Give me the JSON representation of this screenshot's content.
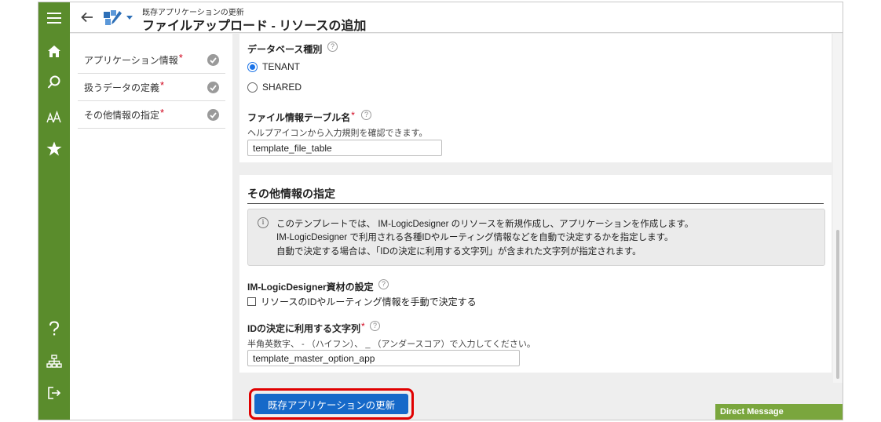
{
  "header": {
    "subtitle": "既存アプリケーションの更新",
    "title": "ファイルアップロード - リソースの追加"
  },
  "rail": {
    "icons": [
      "menu-icon",
      "home-icon",
      "search-icon",
      "font-size-icon",
      "star-icon",
      "help-icon",
      "sitemap-icon",
      "logout-icon"
    ]
  },
  "steps": [
    {
      "label": "アプリケーション情報",
      "required": "*"
    },
    {
      "label": "扱うデータの定義",
      "required": "*"
    },
    {
      "label": "その他情報の指定",
      "required": "*"
    }
  ],
  "db_type": {
    "label": "データベース種別",
    "options": [
      "TENANT",
      "SHARED"
    ],
    "selected": "TENANT"
  },
  "file_table": {
    "label": "ファイル情報テーブル名",
    "required": "*",
    "hint": "ヘルプアイコンから入力規則を確認できます。",
    "value": "template_file_table"
  },
  "other_section": {
    "title": "その他情報の指定",
    "info_lines": [
      "このテンプレートでは、 IM-LogicDesigner のリソースを新規作成し、アプリケーションを作成します。",
      "IM-LogicDesigner で利用される各種IDやルーティング情報などを自動で決定するかを指定します。",
      "自動で決定する場合は、「IDの決定に利用する文字列」が含まれた文字列が指定されます。"
    ]
  },
  "ld_setting": {
    "label": "IM-LogicDesigner資材の設定",
    "checkbox_label": "リソースのIDやルーティング情報を手動で決定する",
    "checked": false
  },
  "id_string": {
    "label": "IDの決定に利用する文字列",
    "required": "*",
    "hint": "半角英数字、 - （ハイフン）、 _ （アンダースコア）で入力してください。",
    "value": "template_master_option_app"
  },
  "submit_label": "既存アプリケーションの更新",
  "direct_message": "Direct Message",
  "help_glyph": "?",
  "info_glyph": "i",
  "colors": {
    "rail": "#5a8c2c",
    "primary": "#1669c9",
    "highlight": "#e00000",
    "required": "#d0021b"
  }
}
